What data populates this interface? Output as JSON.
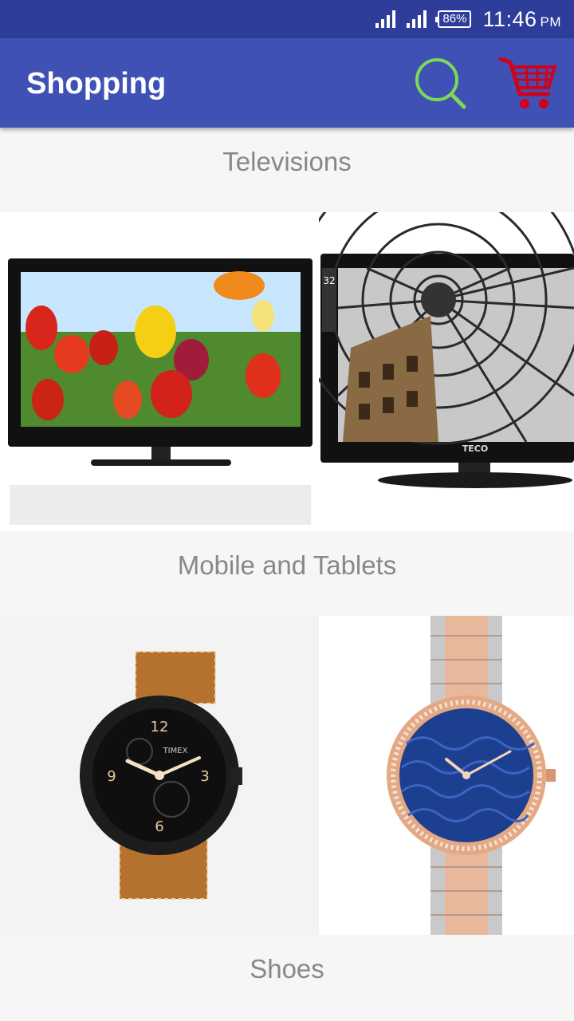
{
  "status_bar": {
    "battery": "86%",
    "time": "11:46",
    "ampm": "PM"
  },
  "app_bar": {
    "title": "Shopping",
    "search_icon": "search-icon",
    "cart_icon": "cart-icon",
    "search_color": "#7ed957",
    "cart_color": "#d0021b"
  },
  "sections": [
    {
      "title": "Televisions",
      "images": [
        "tv-tulips-image",
        "tv-teco-image"
      ]
    },
    {
      "title": "Mobile and Tablets",
      "images": [
        "watch-leather-image",
        "watch-rose-gold-image"
      ]
    },
    {
      "title": "Shoes",
      "images": []
    }
  ],
  "brands": {
    "tv2": "TECO",
    "tv2_badge": "32",
    "watch1": "TIMEX"
  }
}
